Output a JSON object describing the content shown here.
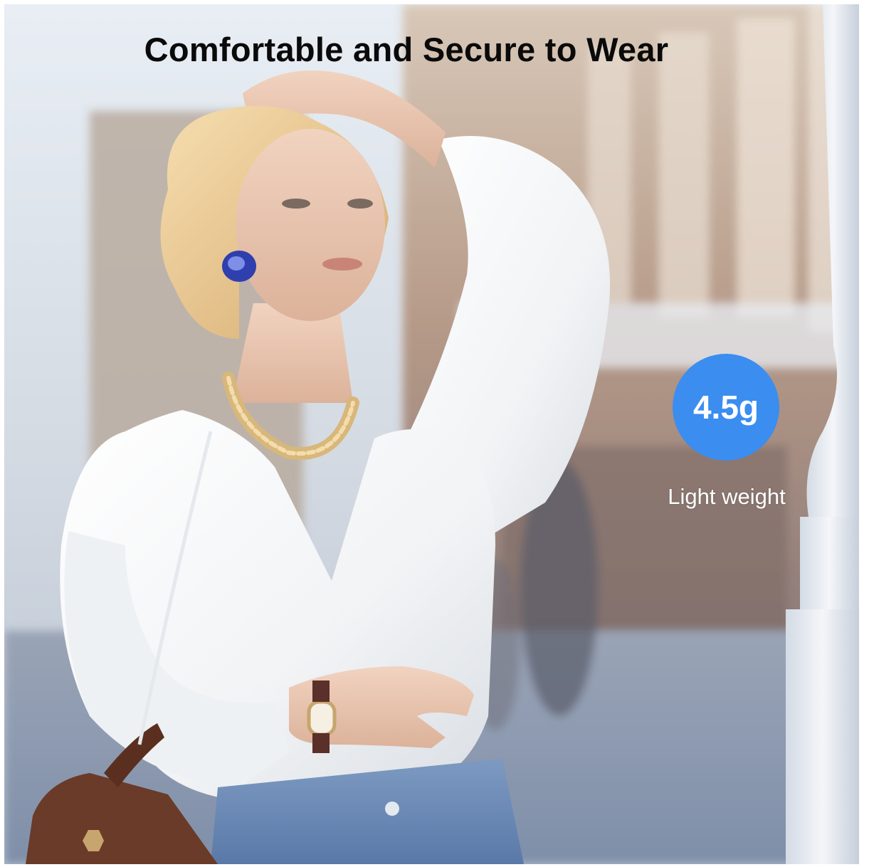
{
  "headline": "Comfortable and Secure to Wear",
  "weight_badge": {
    "value": "4.5g",
    "caption": "Light weight"
  },
  "colors": {
    "badge": "#3b8df0",
    "headline": "#0a0a0a",
    "caption": "#ffffff"
  }
}
